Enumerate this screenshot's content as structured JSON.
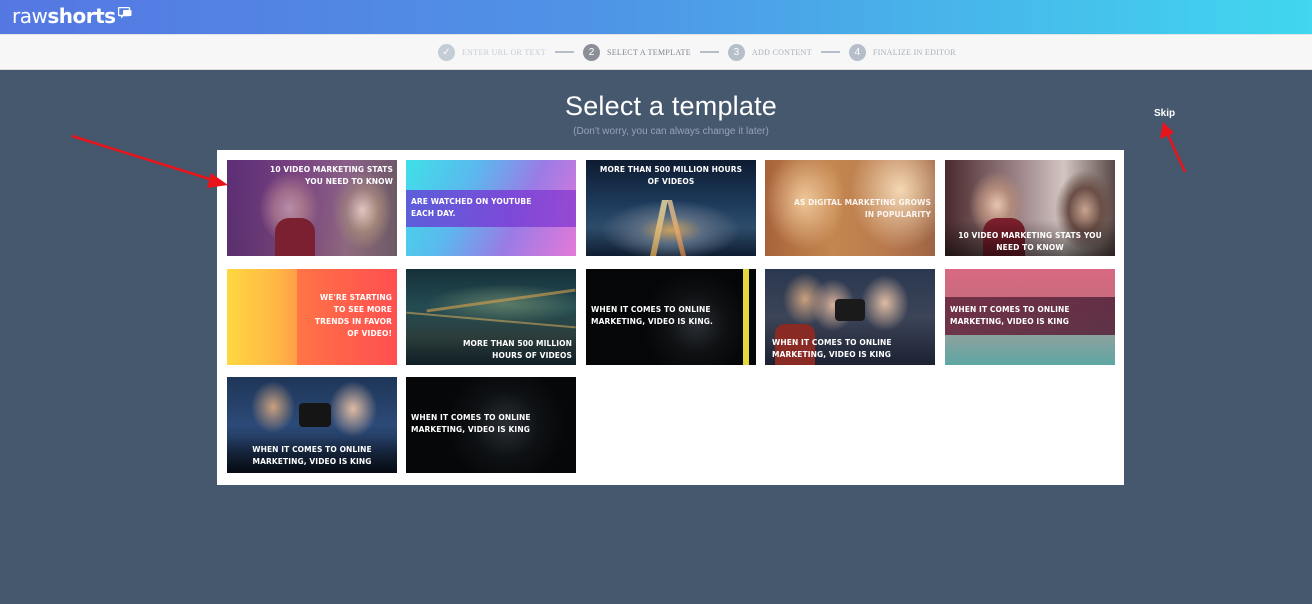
{
  "brand": {
    "logo_light": "raw",
    "logo_bold": "shorts"
  },
  "stepper": [
    {
      "number": "✓",
      "label": "ENTER URL OR TEXT",
      "state": "done"
    },
    {
      "number": "2",
      "label": "SELECT A TEMPLATE",
      "state": "active"
    },
    {
      "number": "3",
      "label": "ADD CONTENT",
      "state": "todo"
    },
    {
      "number": "4",
      "label": "FINALIZE IN EDITOR",
      "state": "todo"
    }
  ],
  "page": {
    "title": "Select a template",
    "subtitle": "(Don't worry, you can always change it later)",
    "skip_label": "Skip"
  },
  "templates": [
    {
      "caption": "10 VIDEO MARKETING STATS YOU NEED TO KNOW",
      "scene": "office-women-purple"
    },
    {
      "caption": "ARE WATCHED ON YOUTUBE EACH DAY.",
      "scene": "gradient-cyan-pink"
    },
    {
      "caption": "MORE THAN 500 MILLION HOURS OF VIDEOS",
      "scene": "city-highway-night"
    },
    {
      "caption": "AS DIGITAL MARKETING GROWS IN POPULARITY",
      "scene": "blurred-warm-crowd"
    },
    {
      "caption": "10 VIDEO MARKETING STATS YOU NEED TO KNOW",
      "scene": "office-women"
    },
    {
      "caption": "WE'RE STARTING TO SEE MORE TRENDS IN FAVOR OF VIDEO!",
      "scene": "gradient-yellow-orange"
    },
    {
      "caption": "MORE THAN 500 MILLION HOURS OF VIDEOS",
      "scene": "city-night-teal"
    },
    {
      "caption": "WHEN IT COMES TO ONLINE MARKETING, VIDEO IS KING.",
      "scene": "camera-lens-dark-yellow"
    },
    {
      "caption": "WHEN IT COMES TO ONLINE MARKETING, VIDEO IS KING",
      "scene": "friends-camera"
    },
    {
      "caption": "WHEN IT COMES TO ONLINE MARKETING, VIDEO IS KING",
      "scene": "pink-teal-band"
    },
    {
      "caption": "WHEN IT COMES TO ONLINE MARKETING, VIDEO IS KING",
      "scene": "friends-camera-blue"
    },
    {
      "caption": "WHEN IT COMES TO ONLINE MARKETING, VIDEO IS KING",
      "scene": "camera-lens-dark"
    }
  ],
  "colors": {
    "background": "#46586e",
    "header_start": "#5577e2",
    "header_end": "#40d7ef",
    "annotation_arrow": "#e8141a"
  }
}
